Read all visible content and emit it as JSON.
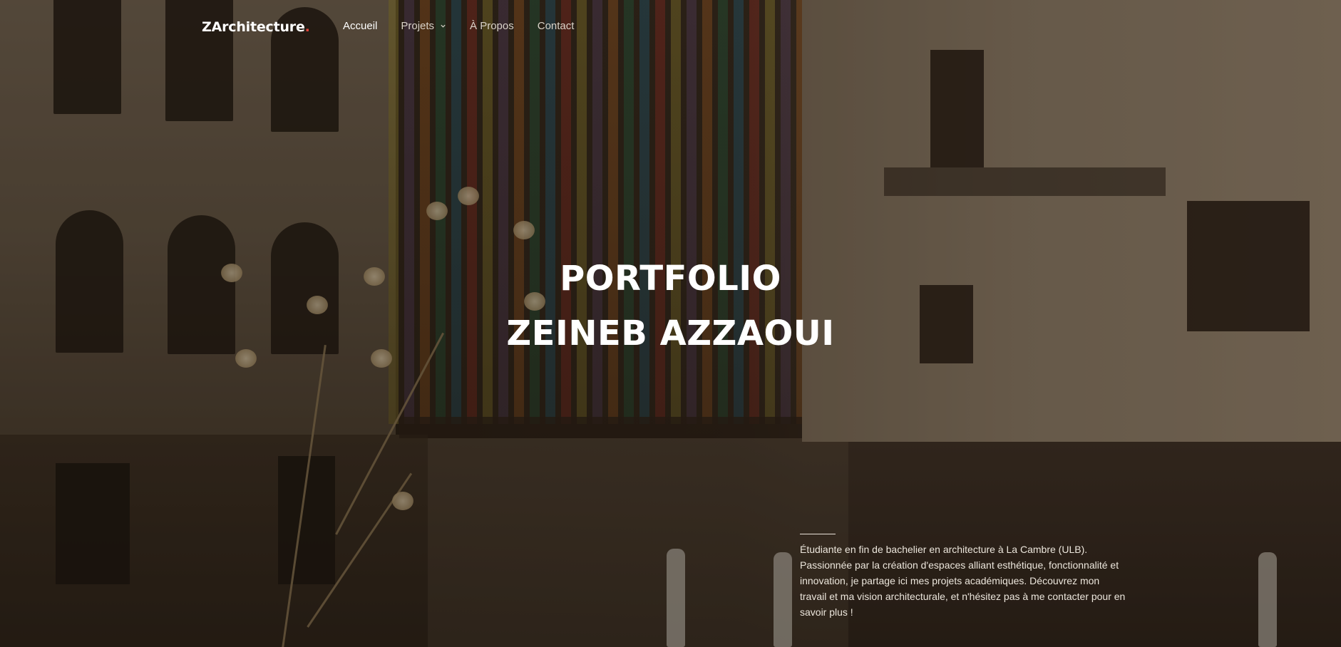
{
  "nav": {
    "logo_text": "ZArchitecture",
    "logo_dot": ".",
    "items": [
      {
        "label": "Accueil",
        "active": true
      },
      {
        "label": "Projets",
        "has_dropdown": true
      },
      {
        "label": "À Propos"
      },
      {
        "label": "Contact"
      }
    ]
  },
  "hero": {
    "title_line1": "PORTFOLIO",
    "title_line2": "ZEINEB AZZAOUI",
    "intro": "Étudiante en fin de bachelier en architecture à La Cambre (ULB). Passionnée par la création d'espaces alliant esthétique, fonctionnalité et innovation, je partage ici mes projets académiques. Découvrez mon travail et ma vision architecturale, et n'hésitez pas à me contacter pour en savoir plus !"
  },
  "colors": {
    "accent_dot": "#e2453a",
    "text_primary": "#ffffff",
    "nav_text": "#d9d2c8"
  },
  "icons": {
    "dropdown": "chevron-down-icon"
  }
}
